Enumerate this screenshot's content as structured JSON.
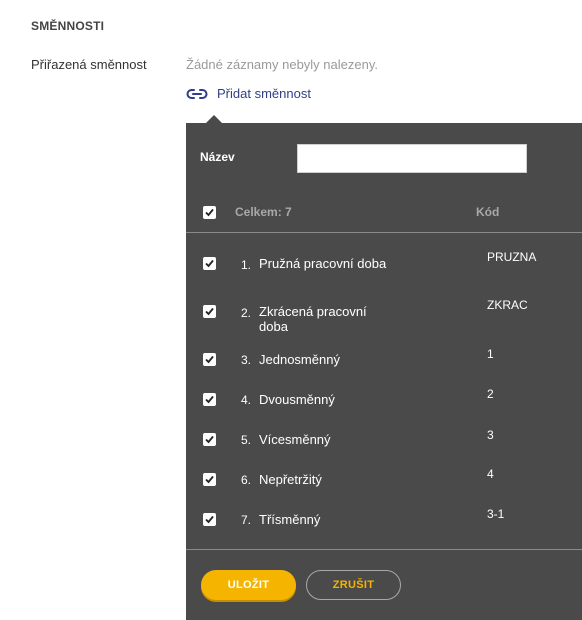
{
  "section": {
    "title": "SMĚNNOSTI"
  },
  "field": {
    "label": "Přiřazená směnnost",
    "empty_message": "Žádné záznamy nebyly nalezeny.",
    "add_link_label": "Přidat směnnost",
    "add_link_icon": "link-icon"
  },
  "popup": {
    "filter_label": "Název",
    "filter_value": "",
    "header": {
      "select_all_checked": true,
      "total_label": "Celkem: 7",
      "code_label": "Kód"
    },
    "rows": [
      {
        "num": "1.",
        "name": "Pružná pracovní doba",
        "code": "PRUZNA",
        "checked": true
      },
      {
        "num": "2.",
        "name": "Zkrácená pracovní doba",
        "code": "ZKRAC",
        "checked": true
      },
      {
        "num": "3.",
        "name": "Jednosměnný",
        "code": "1",
        "checked": true
      },
      {
        "num": "4.",
        "name": "Dvousměnný",
        "code": "2",
        "checked": true
      },
      {
        "num": "5.",
        "name": "Vícesměnný",
        "code": "3",
        "checked": true
      },
      {
        "num": "6.",
        "name": "Nepřetržitý",
        "code": "4",
        "checked": true
      },
      {
        "num": "7.",
        "name": "Třísměnný",
        "code": "3-1",
        "checked": true
      }
    ],
    "save_label": "ULOŽIT",
    "cancel_label": "ZRUŠIT"
  },
  "colors": {
    "popup_bg": "#4a4a4a",
    "accent": "#f5b400",
    "link": "#2f3f88"
  }
}
